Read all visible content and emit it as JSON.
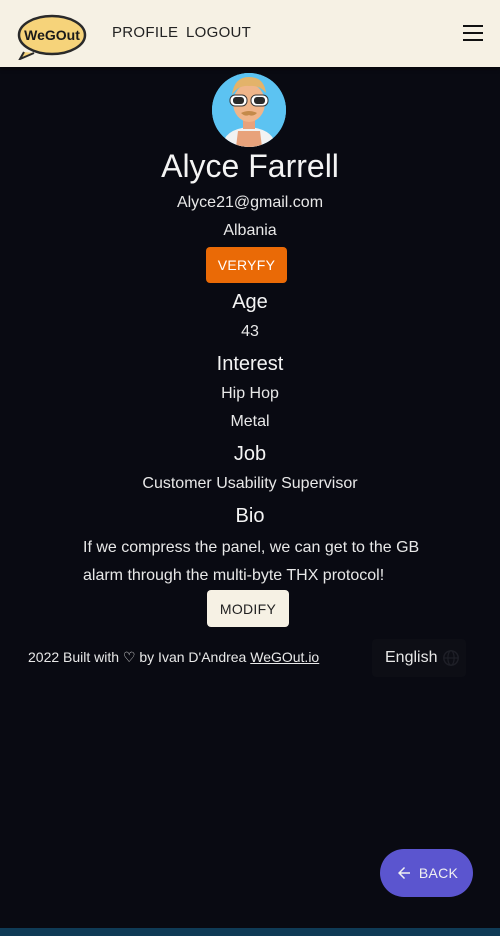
{
  "header": {
    "logo_text": "WeGOut",
    "nav": [
      "PROFILE",
      "LOGOUT"
    ]
  },
  "profile": {
    "name": "Alyce Farrell",
    "email": "Alyce21@gmail.com",
    "country": "Albania",
    "verify_label": "VERYFY",
    "age_label": "Age",
    "age": "43",
    "interest_label": "Interest",
    "interests": [
      "Hip Hop",
      "Metal"
    ],
    "job_label": "Job",
    "job": "Customer Usability Supervisor",
    "bio_label": "Bio",
    "bio_lines": [
      "If we compress the panel, we can get to the GB",
      "alarm through the multi-byte THX protocol!"
    ],
    "modify_label": "MODIFY"
  },
  "footer": {
    "text": "2022 Built with ♡ by Ivan D'Andrea",
    "link": "WeGOut.io",
    "language": "English"
  },
  "back_label": "BACK",
  "colors": {
    "background": "#090a12",
    "topbar": "#f6f1e4",
    "verify": "#ea6a06",
    "back": "#5b55cf"
  }
}
